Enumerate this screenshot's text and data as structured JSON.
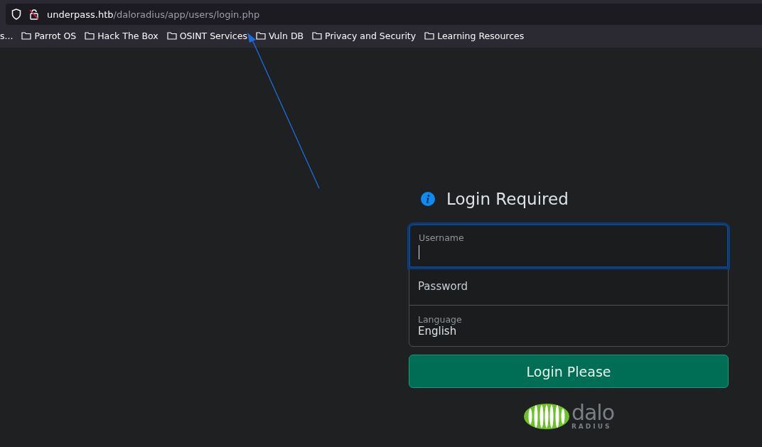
{
  "address_bar": {
    "host": "underpass.htb",
    "path": "/daloradius/app/users/login.php"
  },
  "bookmarks": [
    {
      "label": "s...",
      "kind": "text"
    },
    {
      "label": "Parrot OS",
      "kind": "folder"
    },
    {
      "label": "Hack The Box",
      "kind": "folder"
    },
    {
      "label": "OSINT Services",
      "kind": "folder"
    },
    {
      "label": "Vuln DB",
      "kind": "folder"
    },
    {
      "label": "Privacy and Security",
      "kind": "folder"
    },
    {
      "label": "Learning Resources",
      "kind": "folder"
    }
  ],
  "login": {
    "title": "Login Required",
    "fields": [
      {
        "kind": "input",
        "label": "Username",
        "focused": true
      },
      {
        "kind": "placeholder",
        "placeholder": "Password",
        "focused": false
      },
      {
        "kind": "select",
        "label": "Language",
        "value": "English",
        "focused": false
      }
    ],
    "button": "Login Please",
    "logo": {
      "word": "dalo",
      "sub": "RADIUS"
    }
  }
}
